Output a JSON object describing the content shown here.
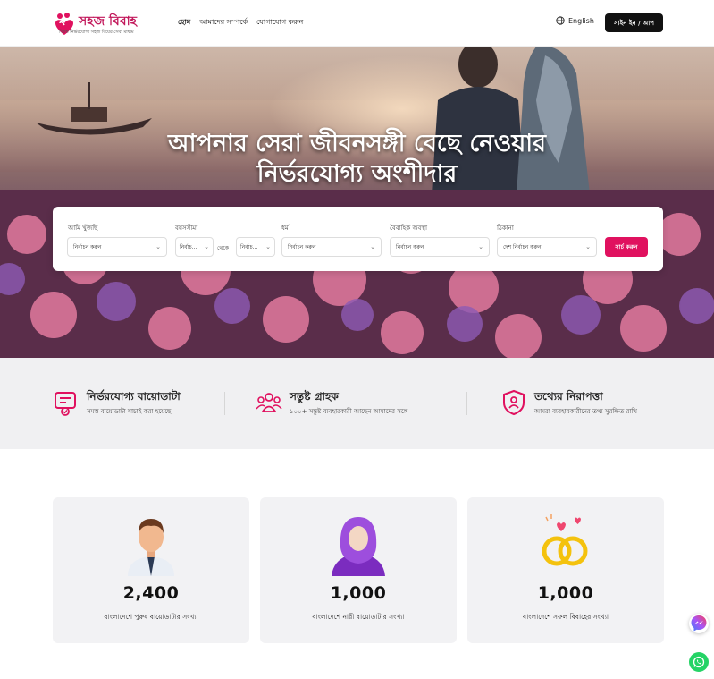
{
  "brand": {
    "name": "সহজ বিবাহ",
    "tagline": "বিশ্বস্ত নির্ভরযোগ্য সহজ বিয়ের সেবা মাধ্যম",
    "accent": "#e0115f"
  },
  "nav": {
    "items": [
      "হোম",
      "আমাদের সম্পর্কে",
      "যোগাযোগ করুন"
    ]
  },
  "header": {
    "language": "English",
    "signin": "সাইন ইন / আপ"
  },
  "hero": {
    "title_line1": "আপনার সেরা জীবনসঙ্গী বেছে নেওয়ার",
    "title_line2": "নির্ভরযোগ্য অংশীদার"
  },
  "search": {
    "looking_label": "আমি খুঁজছি",
    "looking_value": "নির্বাচন করুন",
    "age_label": "বয়সসীমা",
    "age_from": "নির্বাচ...",
    "age_between": "থেকে",
    "age_to": "নির্বাচ...",
    "religion_label": "ধর্ম",
    "religion_value": "নির্বাচন করুন",
    "marital_label": "বৈবাহিক অবস্থা",
    "marital_value": "নির্বাচন করুন",
    "address_label": "ঠিকানা",
    "address_value": "দেশ নির্বাচন করুন",
    "button": "সার্চ করুন"
  },
  "features": [
    {
      "icon": "verified-document-icon",
      "title": "নির্ভরযোগ্য বায়োডাটা",
      "subtitle": "সমস্ত বায়োডাটা যাচাই করা হয়েছে"
    },
    {
      "icon": "users-group-icon",
      "title": "সন্তুষ্ট গ্রাহক",
      "subtitle": "১০০+ সন্তুষ্ট ব্যবহারকারী আছেন আমাদের সঙ্গে"
    },
    {
      "icon": "shield-user-icon",
      "title": "তথ্যের নিরাপত্তা",
      "subtitle": "আমরা ব্যবহারকারীদের তথ্য সুরক্ষিত রাখি"
    }
  ],
  "stats": [
    {
      "icon": "groom-avatar-icon",
      "value": "2,400",
      "label": "বাংলাদেশে পুরুষ বায়োডাটার সংখ্যা"
    },
    {
      "icon": "bride-avatar-icon",
      "value": "1,000",
      "label": "বাংলাদেশে নারী বায়োডাটার সংখ্যা"
    },
    {
      "icon": "wedding-rings-icon",
      "value": "1,000",
      "label": "বাংলাদেশে সফল বিবাহের সংখ্যা"
    }
  ],
  "floating": {
    "messenger_icon": "messenger-icon",
    "whatsapp_icon": "whatsapp-icon"
  }
}
